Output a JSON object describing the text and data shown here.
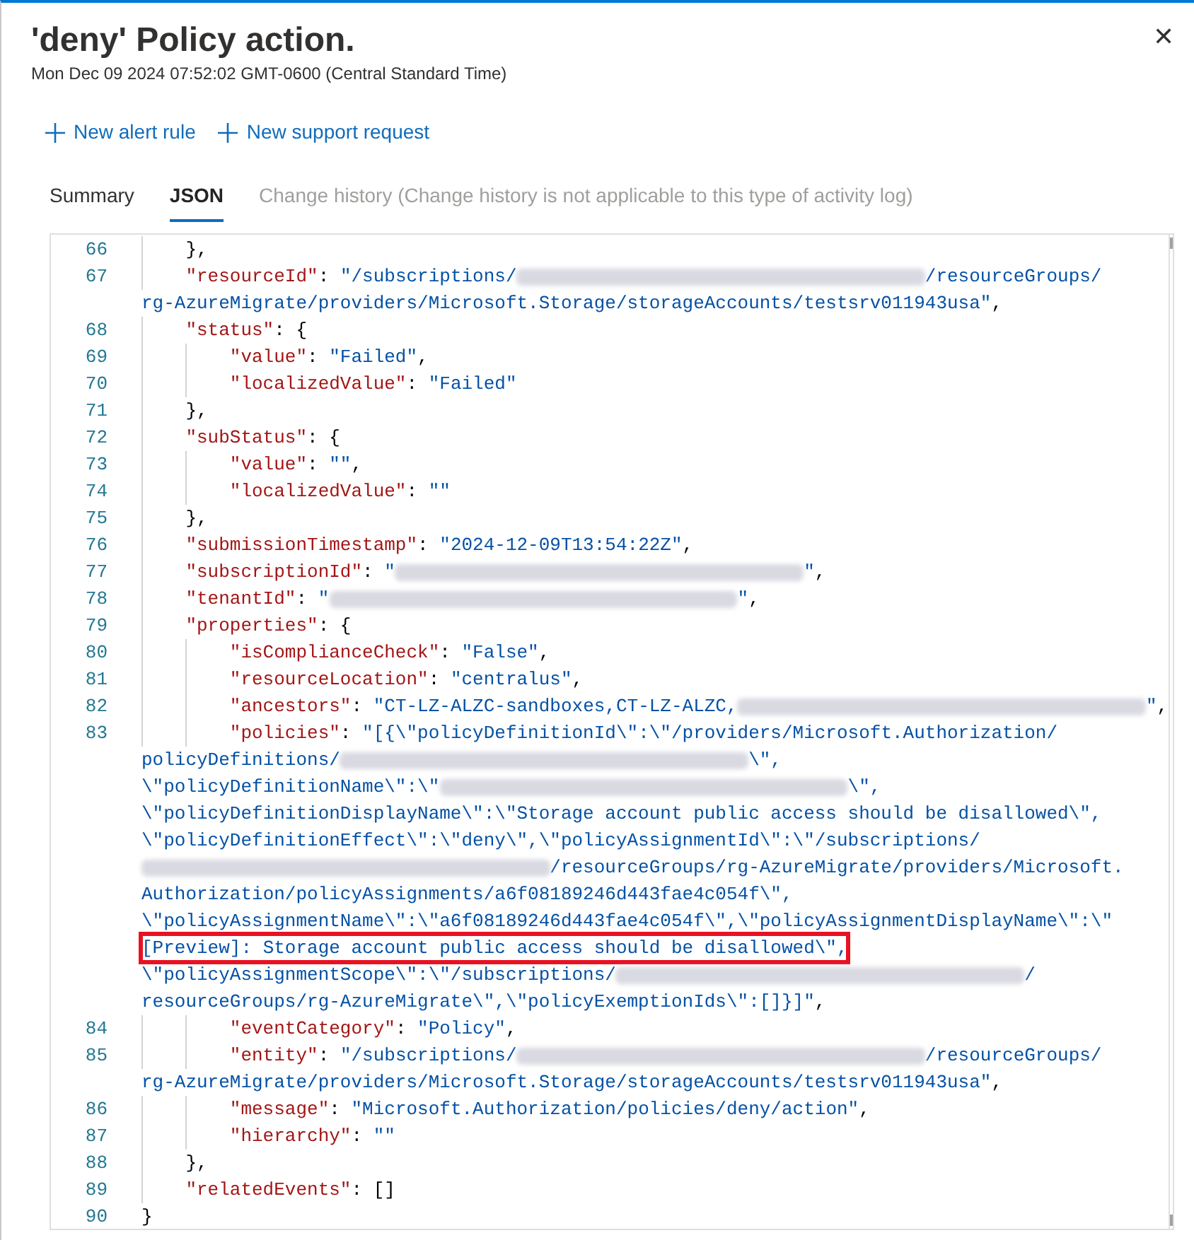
{
  "panel": {
    "title": "'deny' Policy action.",
    "timestamp": "Mon Dec 09 2024 07:52:02 GMT-0600 (Central Standard Time)",
    "close_label": "✕"
  },
  "toolbar": [
    {
      "label": "New alert rule"
    },
    {
      "label": "New support request"
    }
  ],
  "tabs": [
    {
      "label": "Summary",
      "selected": false,
      "disabled": false
    },
    {
      "label": "JSON",
      "selected": true,
      "disabled": false
    },
    {
      "label": "Change history (Change history is not applicable to this type of activity log)",
      "selected": false,
      "disabled": true
    }
  ],
  "code": {
    "lines": [
      {
        "number": "66",
        "segments": [
          {
            "kind": "punct",
            "text": "    },"
          }
        ]
      },
      {
        "number": "67",
        "segments": [
          {
            "kind": "key",
            "text": "    \"resourceId\""
          },
          {
            "kind": "punct",
            "text": ": "
          },
          {
            "kind": "string",
            "text": "\"/subscriptions/"
          },
          {
            "kind": "redacted"
          },
          {
            "kind": "string",
            "text": "/resourceGroups/"
          }
        ]
      },
      {
        "segments": [
          {
            "kind": "string",
            "text": "rg-AzureMigrate/providers/Microsoft.Storage/storageAccounts/testsrv011943usa\""
          },
          {
            "kind": "punct",
            "text": ","
          }
        ]
      },
      {
        "number": "68",
        "segments": [
          {
            "kind": "key",
            "text": "    \"status\""
          },
          {
            "kind": "punct",
            "text": ": {"
          }
        ]
      },
      {
        "number": "69",
        "segments": [
          {
            "kind": "key",
            "text": "        \"value\""
          },
          {
            "kind": "punct",
            "text": ": "
          },
          {
            "kind": "string",
            "text": "\"Failed\""
          },
          {
            "kind": "punct",
            "text": ","
          }
        ]
      },
      {
        "number": "70",
        "segments": [
          {
            "kind": "key",
            "text": "        \"localizedValue\""
          },
          {
            "kind": "punct",
            "text": ": "
          },
          {
            "kind": "string",
            "text": "\"Failed\""
          }
        ]
      },
      {
        "number": "71",
        "segments": [
          {
            "kind": "punct",
            "text": "    },"
          }
        ]
      },
      {
        "number": "72",
        "segments": [
          {
            "kind": "key",
            "text": "    \"subStatus\""
          },
          {
            "kind": "punct",
            "text": ": {"
          }
        ]
      },
      {
        "number": "73",
        "segments": [
          {
            "kind": "key",
            "text": "        \"value\""
          },
          {
            "kind": "punct",
            "text": ": "
          },
          {
            "kind": "string",
            "text": "\"\""
          },
          {
            "kind": "punct",
            "text": ","
          }
        ]
      },
      {
        "number": "74",
        "segments": [
          {
            "kind": "key",
            "text": "        \"localizedValue\""
          },
          {
            "kind": "punct",
            "text": ": "
          },
          {
            "kind": "string",
            "text": "\"\""
          }
        ]
      },
      {
        "number": "75",
        "segments": [
          {
            "kind": "punct",
            "text": "    },"
          }
        ]
      },
      {
        "number": "76",
        "segments": [
          {
            "kind": "key",
            "text": "    \"submissionTimestamp\""
          },
          {
            "kind": "punct",
            "text": ": "
          },
          {
            "kind": "string",
            "text": "\"2024-12-09T13:54:22Z\""
          },
          {
            "kind": "punct",
            "text": ","
          }
        ]
      },
      {
        "number": "77",
        "segments": [
          {
            "kind": "key",
            "text": "    \"subscriptionId\""
          },
          {
            "kind": "punct",
            "text": ": "
          },
          {
            "kind": "string",
            "text": "\""
          },
          {
            "kind": "redacted"
          },
          {
            "kind": "string",
            "text": "\""
          },
          {
            "kind": "punct",
            "text": ","
          }
        ]
      },
      {
        "number": "78",
        "segments": [
          {
            "kind": "key",
            "text": "    \"tenantId\""
          },
          {
            "kind": "punct",
            "text": ": "
          },
          {
            "kind": "string",
            "text": "\""
          },
          {
            "kind": "redacted"
          },
          {
            "kind": "string",
            "text": "\""
          },
          {
            "kind": "punct",
            "text": ","
          }
        ]
      },
      {
        "number": "79",
        "segments": [
          {
            "kind": "key",
            "text": "    \"properties\""
          },
          {
            "kind": "punct",
            "text": ": {"
          }
        ]
      },
      {
        "number": "80",
        "segments": [
          {
            "kind": "key",
            "text": "        \"isComplianceCheck\""
          },
          {
            "kind": "punct",
            "text": ": "
          },
          {
            "kind": "string",
            "text": "\"False\""
          },
          {
            "kind": "punct",
            "text": ","
          }
        ]
      },
      {
        "number": "81",
        "segments": [
          {
            "kind": "key",
            "text": "        \"resourceLocation\""
          },
          {
            "kind": "punct",
            "text": ": "
          },
          {
            "kind": "string",
            "text": "\"centralus\""
          },
          {
            "kind": "punct",
            "text": ","
          }
        ]
      },
      {
        "number": "82",
        "segments": [
          {
            "kind": "key",
            "text": "        \"ancestors\""
          },
          {
            "kind": "punct",
            "text": ": "
          },
          {
            "kind": "string",
            "text": "\"CT-LZ-ALZC-sandboxes,CT-LZ-ALZC,"
          },
          {
            "kind": "redacted"
          },
          {
            "kind": "string",
            "text": "\""
          },
          {
            "kind": "punct",
            "text": ","
          }
        ]
      },
      {
        "number": "83",
        "segments": [
          {
            "kind": "key",
            "text": "        \"policies\""
          },
          {
            "kind": "punct",
            "text": ": "
          },
          {
            "kind": "string",
            "text": "\"[{\\\"policyDefinitionId\\\":\\\"/providers/Microsoft.Authorization/"
          }
        ]
      },
      {
        "segments": [
          {
            "kind": "string",
            "text": "policyDefinitions/"
          },
          {
            "kind": "redacted"
          },
          {
            "kind": "string",
            "text": "\\\","
          }
        ]
      },
      {
        "segments": [
          {
            "kind": "string",
            "text": "\\\"policyDefinitionName\\\":\\\""
          },
          {
            "kind": "redacted"
          },
          {
            "kind": "string",
            "text": "\\\","
          }
        ]
      },
      {
        "segments": [
          {
            "kind": "string",
            "text": "\\\"policyDefinitionDisplayName\\\":\\\"Storage account public access should be disallowed\\\","
          }
        ]
      },
      {
        "segments": [
          {
            "kind": "string",
            "text": "\\\"policyDefinitionEffect\\\":\\\"deny\\\",\\\"policyAssignmentId\\\":\\\"/subscriptions/"
          }
        ]
      },
      {
        "segments": [
          {
            "kind": "redacted"
          },
          {
            "kind": "string",
            "text": "/resourceGroups/rg-AzureMigrate/providers/Microsoft."
          }
        ]
      },
      {
        "segments": [
          {
            "kind": "string",
            "text": "Authorization/policyAssignments/a6f08189246d443fae4c054f\\\","
          }
        ]
      },
      {
        "segments": [
          {
            "kind": "string",
            "text": "\\\"policyAssignmentName\\\":\\\"a6f08189246d443fae4c054f\\\",\\\"policyAssignmentDisplayName\\\":\\\""
          }
        ]
      },
      {
        "highlighted": true,
        "segments": [
          {
            "kind": "string",
            "text": "[Preview]: Storage account public access should be disallowed\\\","
          }
        ]
      },
      {
        "segments": [
          {
            "kind": "string",
            "text": "\\\"policyAssignmentScope\\\":\\\"/subscriptions/"
          },
          {
            "kind": "redacted"
          },
          {
            "kind": "string",
            "text": "/"
          }
        ]
      },
      {
        "segments": [
          {
            "kind": "string",
            "text": "resourceGroups/rg-AzureMigrate\\\",\\\"policyExemptionIds\\\":[]}]\""
          },
          {
            "kind": "punct",
            "text": ","
          }
        ]
      },
      {
        "number": "84",
        "segments": [
          {
            "kind": "key",
            "text": "        \"eventCategory\""
          },
          {
            "kind": "punct",
            "text": ": "
          },
          {
            "kind": "string",
            "text": "\"Policy\""
          },
          {
            "kind": "punct",
            "text": ","
          }
        ]
      },
      {
        "number": "85",
        "segments": [
          {
            "kind": "key",
            "text": "        \"entity\""
          },
          {
            "kind": "punct",
            "text": ": "
          },
          {
            "kind": "string",
            "text": "\"/subscriptions/"
          },
          {
            "kind": "redacted"
          },
          {
            "kind": "string",
            "text": "/resourceGroups/"
          }
        ]
      },
      {
        "segments": [
          {
            "kind": "string",
            "text": "rg-AzureMigrate/providers/Microsoft.Storage/storageAccounts/testsrv011943usa\""
          },
          {
            "kind": "punct",
            "text": ","
          }
        ]
      },
      {
        "number": "86",
        "segments": [
          {
            "kind": "key",
            "text": "        \"message\""
          },
          {
            "kind": "punct",
            "text": ": "
          },
          {
            "kind": "string",
            "text": "\"Microsoft.Authorization/policies/deny/action\""
          },
          {
            "kind": "punct",
            "text": ","
          }
        ]
      },
      {
        "number": "87",
        "segments": [
          {
            "kind": "key",
            "text": "        \"hierarchy\""
          },
          {
            "kind": "punct",
            "text": ": "
          },
          {
            "kind": "string",
            "text": "\"\""
          }
        ]
      },
      {
        "number": "88",
        "segments": [
          {
            "kind": "punct",
            "text": "    },"
          }
        ]
      },
      {
        "number": "89",
        "segments": [
          {
            "kind": "key",
            "text": "    \"relatedEvents\""
          },
          {
            "kind": "punct",
            "text": ": []"
          }
        ]
      },
      {
        "number": "90",
        "segments": [
          {
            "kind": "punct",
            "text": "}"
          }
        ]
      }
    ]
  }
}
